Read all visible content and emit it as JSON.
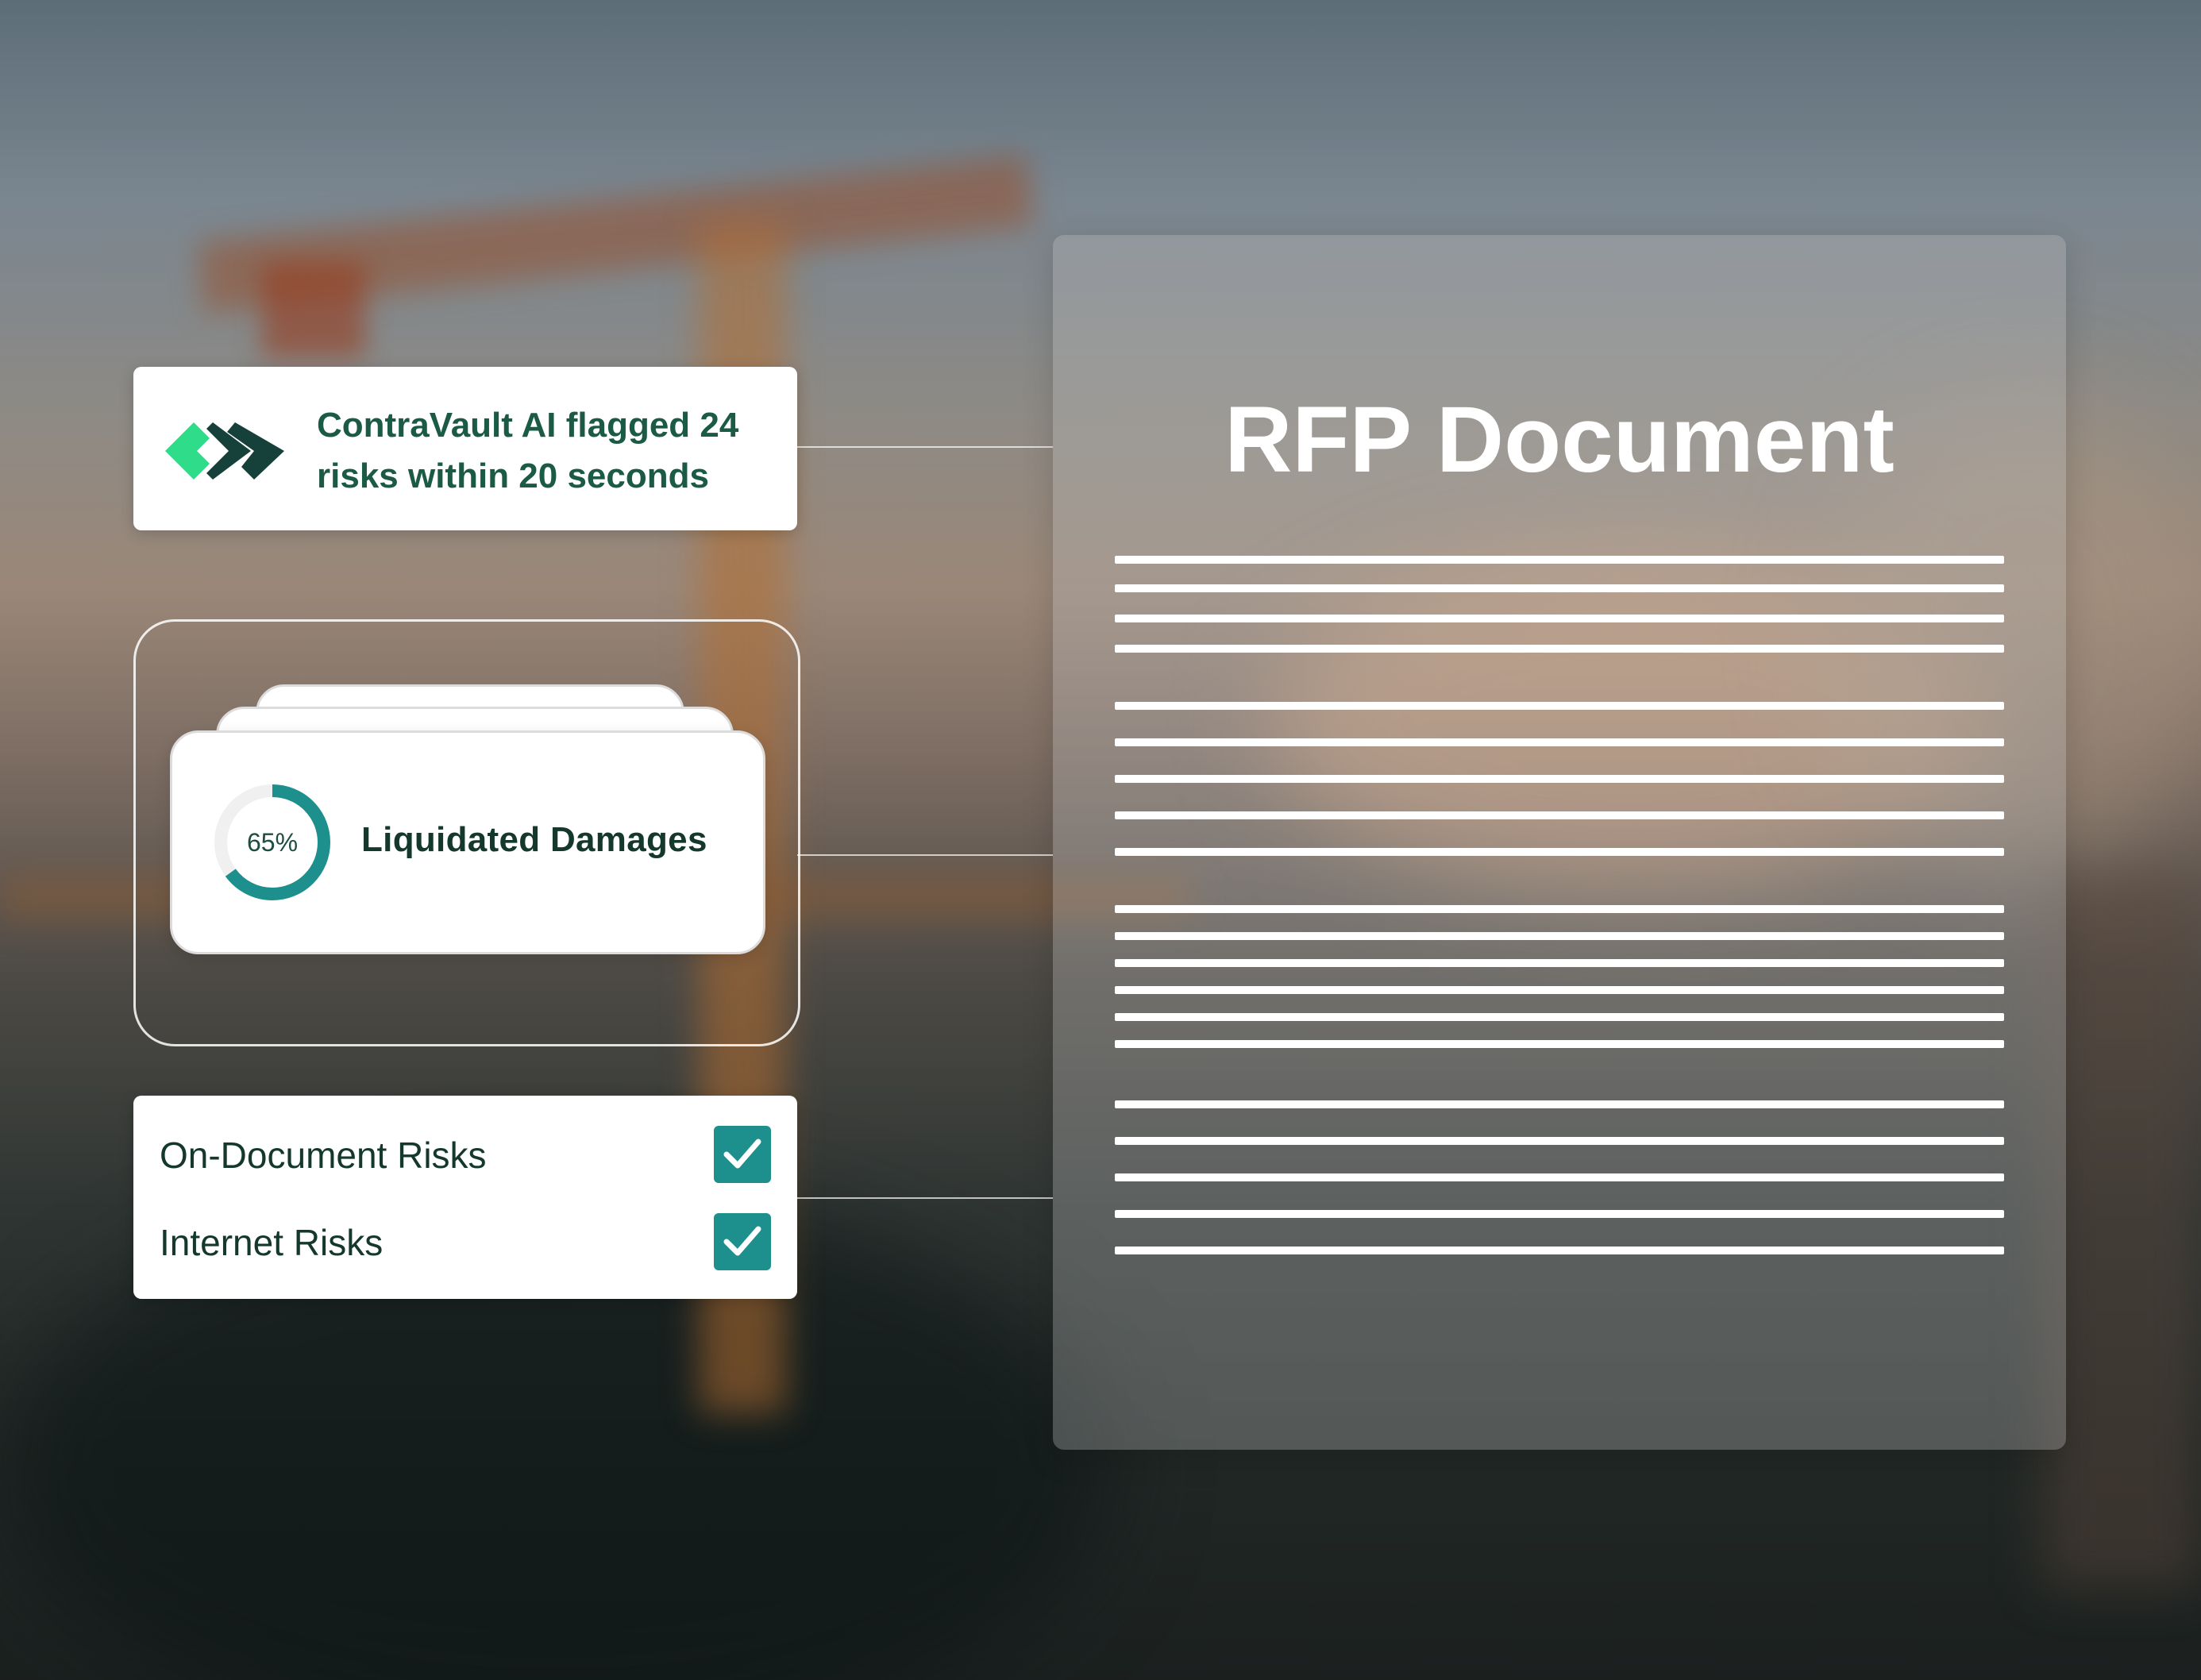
{
  "flag_card": {
    "message": "ContraVault AI flagged 24 risks within 20 seconds",
    "logo_icon": "contravault-logo-icon",
    "text_color": "#1b5a44",
    "logo_colors": [
      "#2fdc8a",
      "#16403a"
    ]
  },
  "risk_category": {
    "label": "Liquidated Damages",
    "progress_percent": 65,
    "progress_label": "65%",
    "ring_color": "#1d8f8c"
  },
  "risk_sources": {
    "items": [
      {
        "label": "On-Document Risks",
        "checked": true
      },
      {
        "label": "Internet Risks",
        "checked": true
      }
    ],
    "check_color": "#1d8f8c"
  },
  "document": {
    "title": "RFP Document"
  }
}
